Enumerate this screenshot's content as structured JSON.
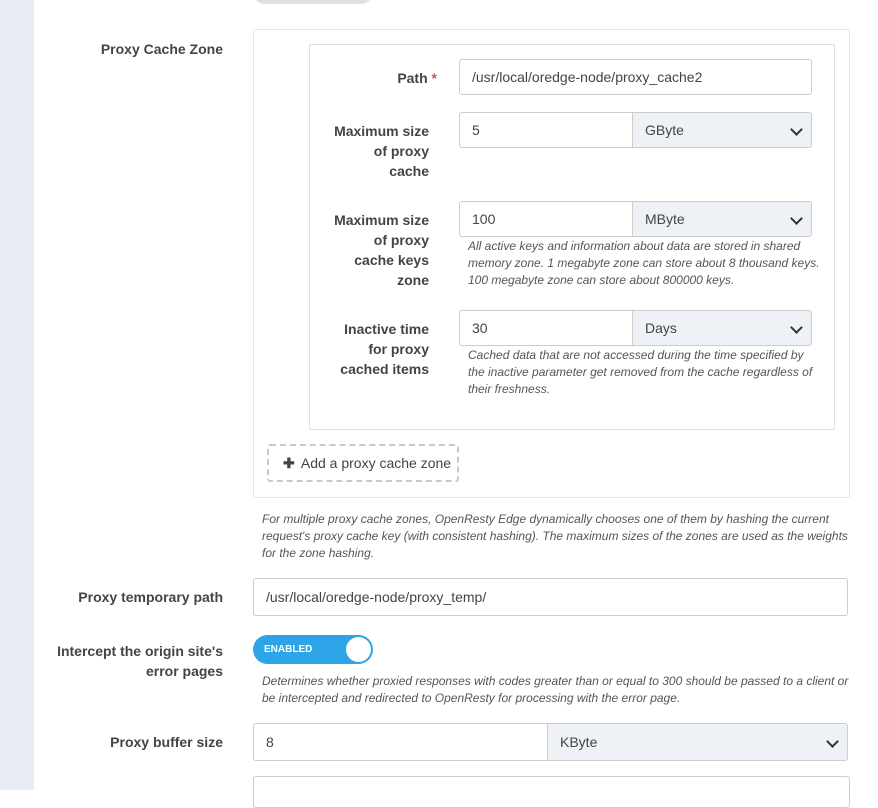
{
  "proxy_cache_zone": {
    "section_label": "Proxy Cache Zone",
    "path": {
      "label": "Path",
      "required_mark": "*",
      "value": "/usr/local/oredge-node/proxy_cache2"
    },
    "max_size": {
      "label_lines": [
        "Maximum size",
        "of proxy",
        "cache"
      ],
      "value": "5",
      "unit": "GByte"
    },
    "keys_zone": {
      "label_lines": [
        "Maximum size",
        "of proxy",
        "cache keys",
        "zone"
      ],
      "value": "100",
      "unit": "MByte",
      "help_lines": [
        "All active keys and information about data are stored in shared",
        "memory zone. 1 megabyte zone can store about 8 thousand keys.",
        "100 megabyte zone can store about 800000 keys."
      ]
    },
    "inactive": {
      "label_lines": [
        "Inactive time",
        "for proxy",
        "cached items"
      ],
      "value": "30",
      "unit": "Days",
      "help_lines": [
        "Cached data that are not accessed during the time specified by",
        "the inactive parameter get removed from the cache regardless of",
        "their freshness."
      ]
    },
    "add_button_label": "Add a proxy cache zone",
    "help_lines": [
      "For multiple proxy cache zones, OpenResty Edge dynamically chooses one of them by hashing the current",
      "request's proxy cache key (with consistent hashing). The maximum sizes of the zones are used as the weights",
      "for the zone hashing."
    ]
  },
  "proxy_temp": {
    "label": "Proxy temporary path",
    "value": "/usr/local/oredge-node/proxy_temp/"
  },
  "intercept": {
    "label_lines": [
      "Intercept the origin site's",
      "error pages"
    ],
    "toggle_text": "ENABLED",
    "help_lines": [
      "Determines whether proxied responses with codes greater than or equal to 300 should be passed to a client or",
      "be intercepted and redirected to OpenResty for processing with the error page."
    ]
  },
  "buffer_size": {
    "label": "Proxy buffer size",
    "value": "8",
    "unit": "KByte"
  }
}
